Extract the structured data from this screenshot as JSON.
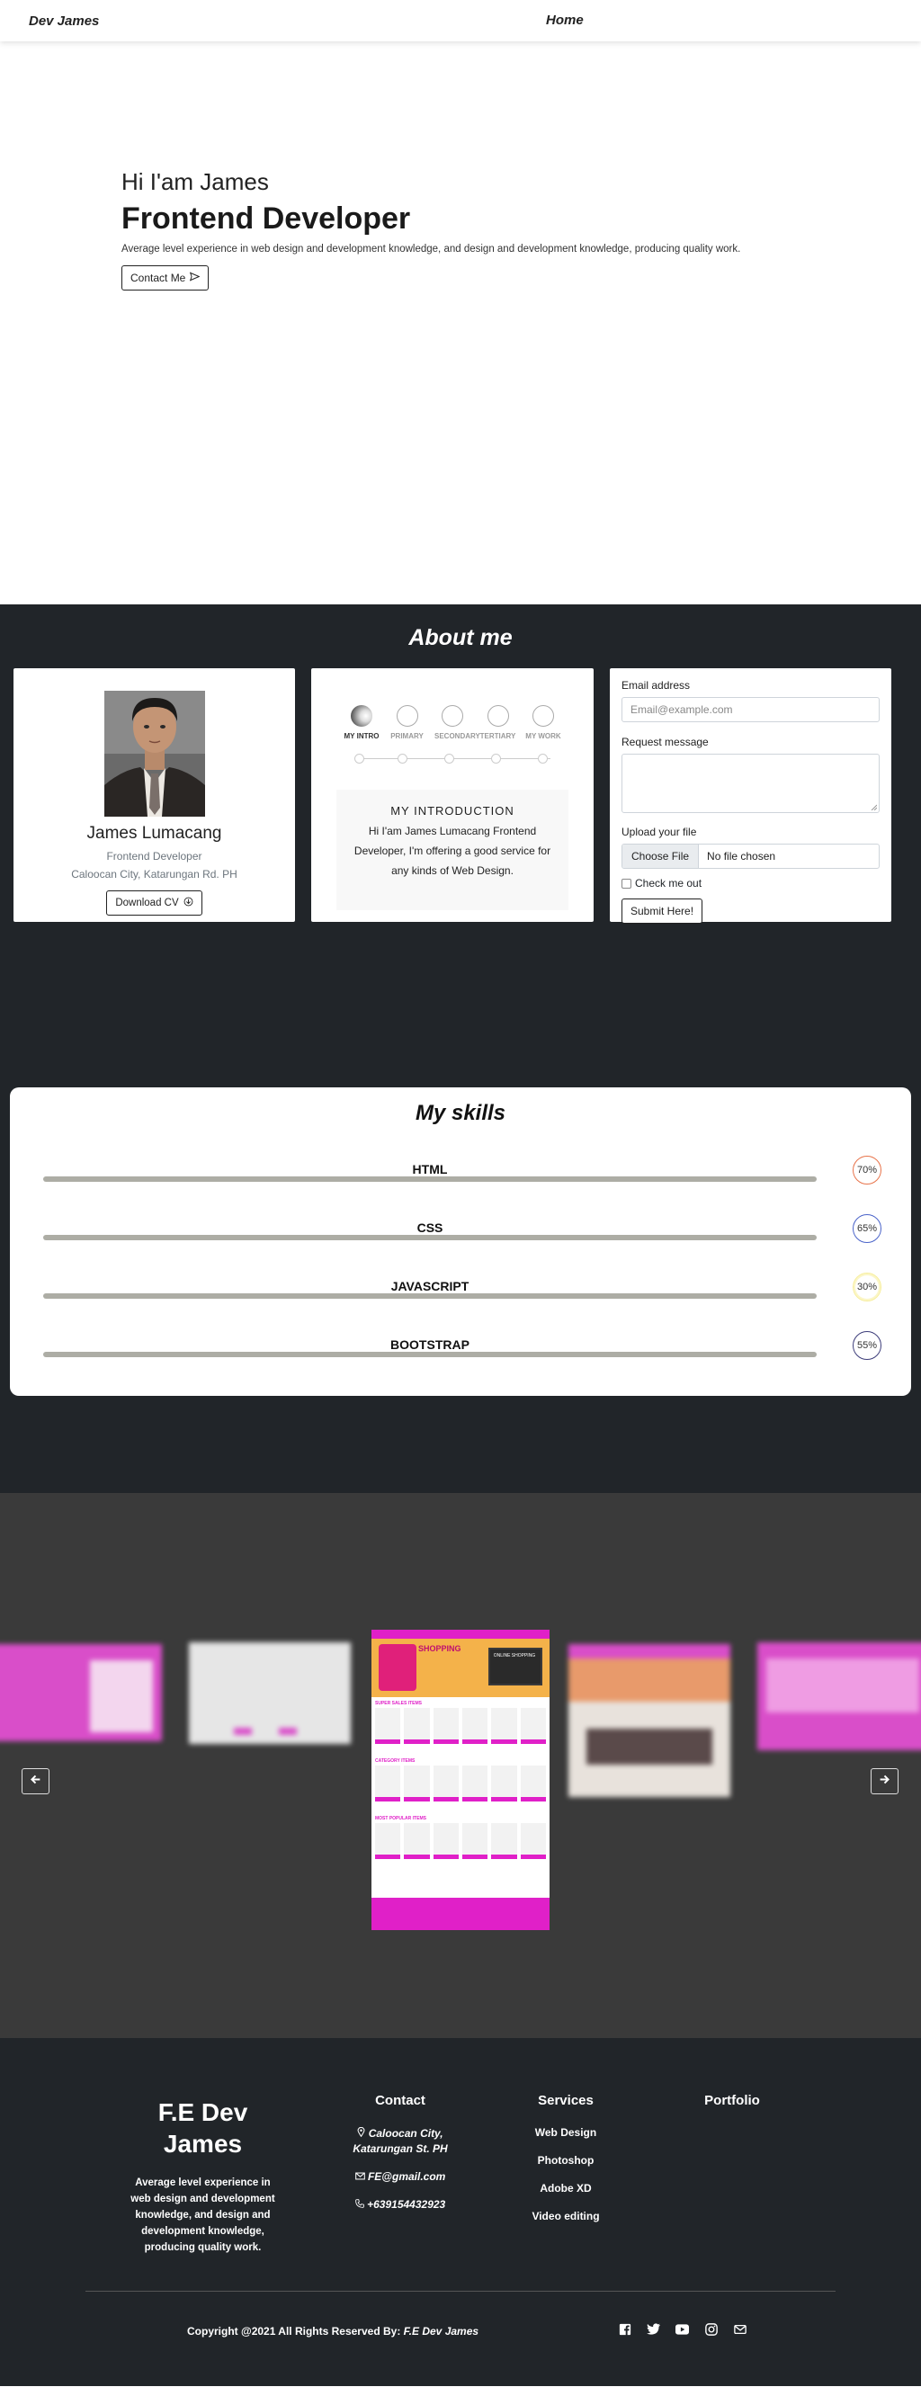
{
  "nav": {
    "brand": "Dev James",
    "home": "Home"
  },
  "hero": {
    "greeting": "Hi I'am James",
    "role": "Frontend Developer",
    "description": "Average level experience in web design and development knowledge, and design and development knowledge, producing quality work.",
    "contact_button": "Contact Me"
  },
  "about": {
    "title": "About me",
    "profile": {
      "name": "James Lumacang",
      "title": "Frontend Developer",
      "address": "Caloocan City, Katarungan Rd. PH",
      "download_button": "Download CV"
    },
    "steps": [
      "MY INTRO",
      "PRIMARY",
      "SECONDARY",
      "TERTIARY",
      "MY WORK"
    ],
    "intro": {
      "title": "MY INTRODUCTION",
      "text": "Hi I'am James Lumacang Frontend Developer, I'm offering a good service for any kinds of Web Design."
    },
    "form": {
      "email_label": "Email address",
      "email_placeholder": "Email@example.com",
      "message_label": "Request message",
      "upload_label": "Upload your file",
      "choose_file": "Choose File",
      "no_file": "No file chosen",
      "check_label": "Check me out",
      "submit": "Submit Here!"
    }
  },
  "skills": {
    "title": "My skills",
    "items": [
      {
        "name": "HTML",
        "percent": "70%",
        "color": "#e8734a"
      },
      {
        "name": "CSS",
        "percent": "65%",
        "color": "#4a63c9"
      },
      {
        "name": "JAVASCRIPT",
        "percent": "30%",
        "color": "#f2e34a"
      },
      {
        "name": "BOOTSTRAP",
        "percent": "55%",
        "color": "#3d3d7a"
      }
    ]
  },
  "carousel": {
    "prev_icon": "arrow-left-icon",
    "next_icon": "arrow-right-icon",
    "active_slide": {
      "header_banner": "SHOPPING",
      "promo_sign": "ONLINE SHOPPING",
      "section_1": "SUPER SALES ITEMS",
      "section_2": "CATEGORY ITEMS",
      "section_3": "MOST POPULAR ITEMS"
    }
  },
  "footer": {
    "brand": "F.E Dev James",
    "description": "Average level experience in web design and development knowledge, and design and development knowledge, producing quality work.",
    "contact": {
      "title": "Contact",
      "address": "Caloocan City, Katarungan St. PH",
      "email": "FE@gmail.com",
      "phone": "+639154432923"
    },
    "services": {
      "title": "Services",
      "items": [
        "Web Design",
        "Photoshop",
        "Adobe XD",
        "Video editing"
      ]
    },
    "portfolio": {
      "title": "Portfolio"
    },
    "copyright_prefix": "Copyright @2021 All Rights Reserved By:",
    "copyright_name": "F.E Dev James",
    "socials": [
      "facebook-icon",
      "twitter-icon",
      "youtube-icon",
      "instagram-icon",
      "mail-icon"
    ]
  }
}
